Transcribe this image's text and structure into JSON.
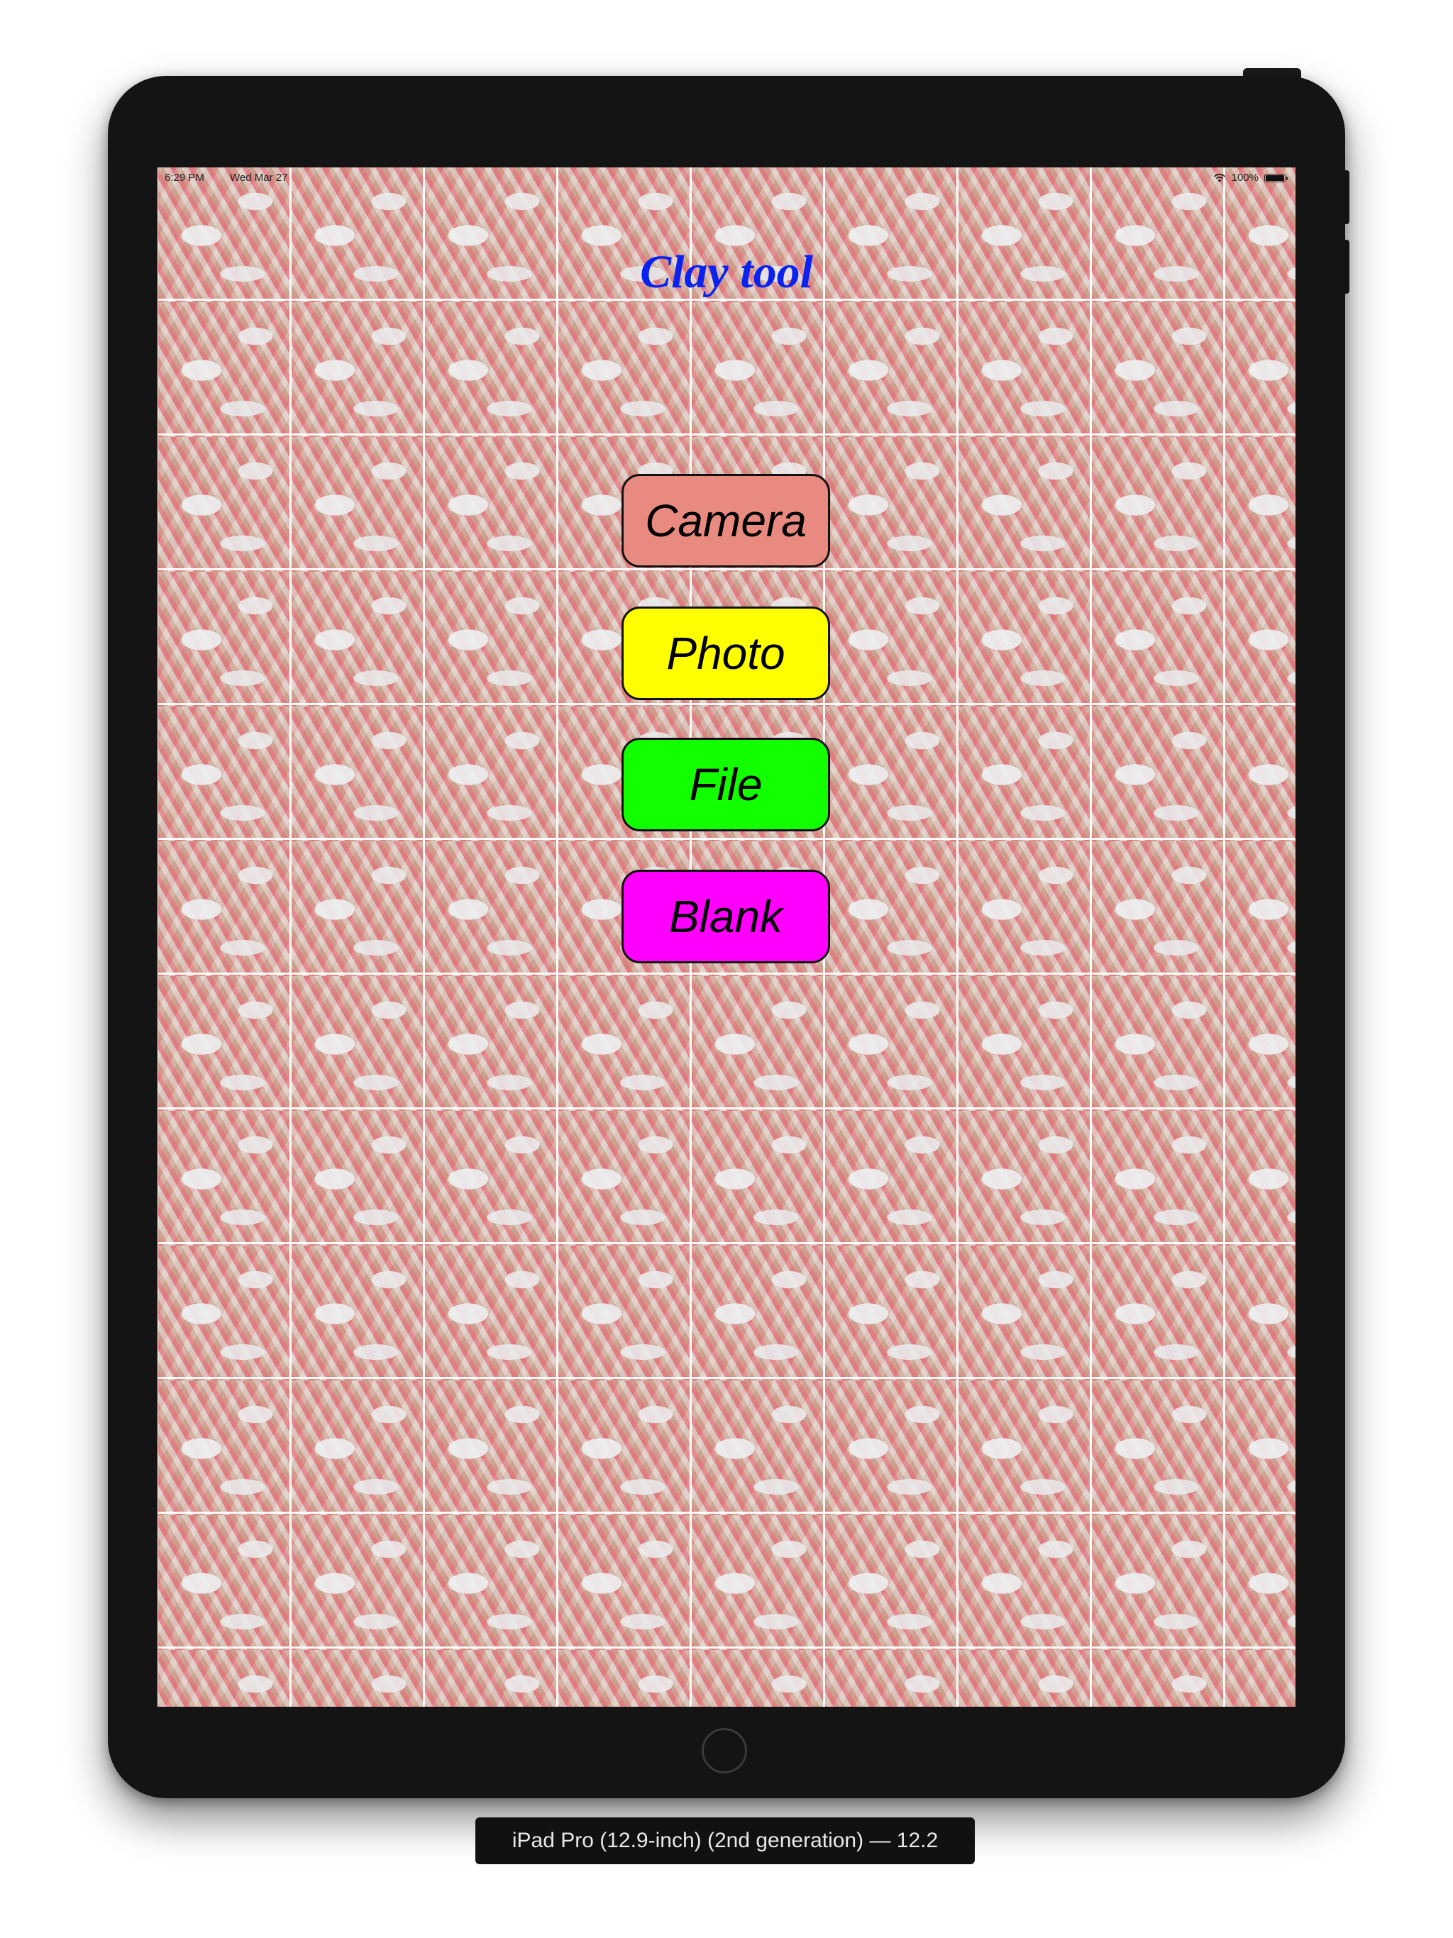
{
  "status_bar": {
    "time": "6:29 PM",
    "date": "Wed Mar 27",
    "battery": "100%",
    "icons": [
      "wifi-icon",
      "battery-icon"
    ]
  },
  "app": {
    "title": "Clay tool"
  },
  "buttons": [
    {
      "label": "Camera",
      "color": "#e98a80"
    },
    {
      "label": "Photo",
      "color": "#ffff00"
    },
    {
      "label": "File",
      "color": "#12ff00"
    },
    {
      "label": "Blank",
      "color": "#ff00ff"
    }
  ],
  "simulator": {
    "device_label": "iPad Pro (12.9-inch) (2nd generation) — 12.2"
  },
  "colors": {
    "title": "#0a22f0",
    "frame": "#141414"
  }
}
